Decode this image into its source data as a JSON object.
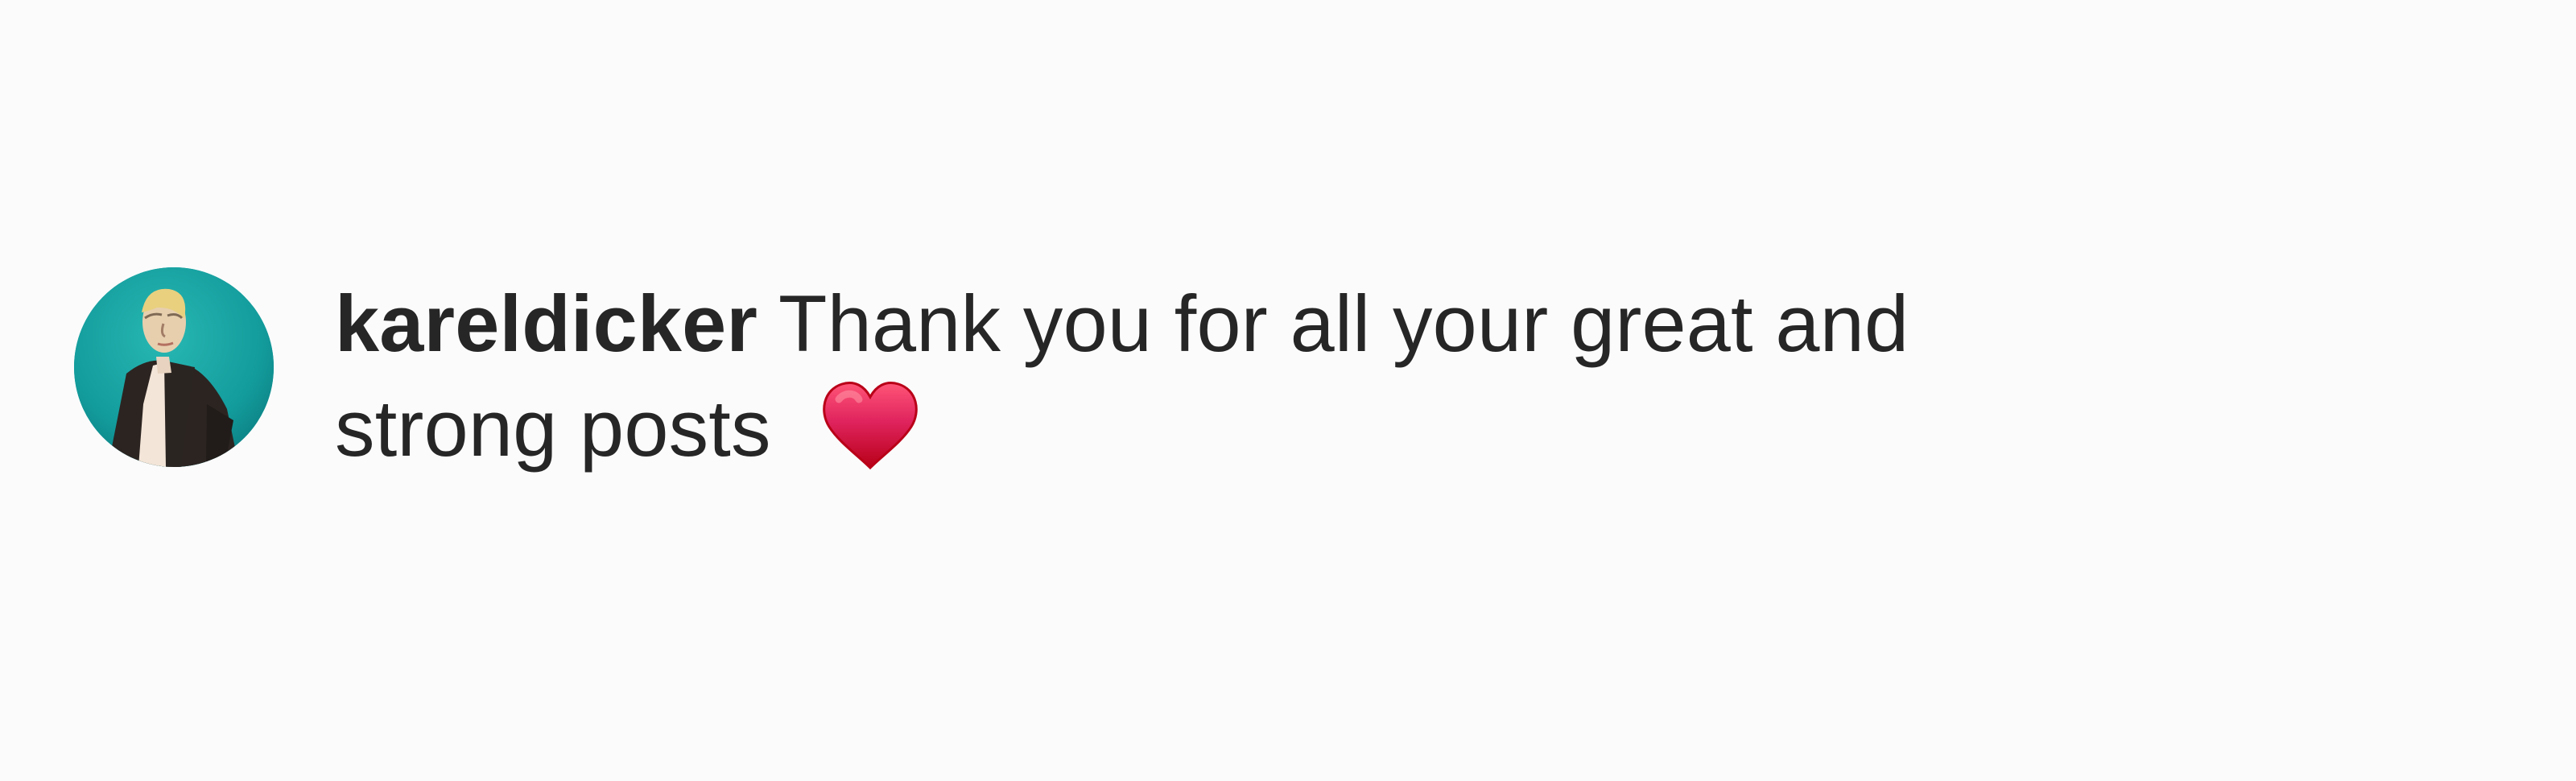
{
  "comment": {
    "avatar_icon": "profile-avatar-icon",
    "username": "kareldicker",
    "text_line_1": "Thank you for all your great and",
    "text_line_2": "strong posts",
    "emoji_icon": "red-heart-icon"
  },
  "colors": {
    "background": "#fbfbfb",
    "text": "#262626",
    "avatar_background": "#149b9b",
    "heart": "#e0245e"
  }
}
